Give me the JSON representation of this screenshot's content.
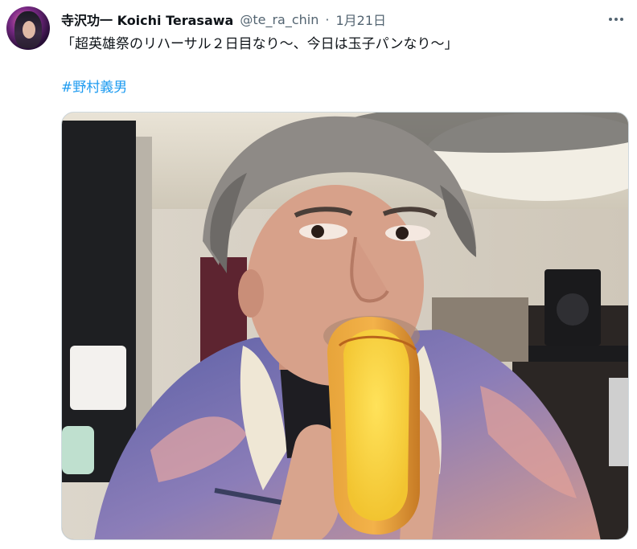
{
  "tweet": {
    "display_name": "寺沢功一 Koichi Terasawa",
    "handle": "@te_ra_chin",
    "separator": "·",
    "date": "1月21日",
    "text": "「超英雄祭のリハーサル２日目なり〜、今日は玉子パンなり〜」",
    "hashtag": "#野村義男"
  },
  "icons": {
    "more": "more-horizontal-icon"
  },
  "colors": {
    "link": "#1d9bf0",
    "secondary_text": "#536471",
    "primary_text": "#0f1419"
  }
}
